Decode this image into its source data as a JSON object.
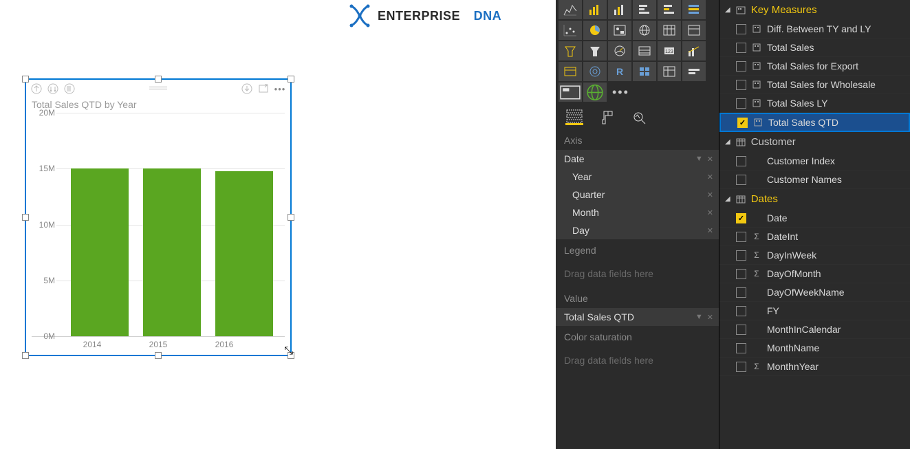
{
  "logo": {
    "ent": "ENTERPRISE",
    "dna": "DNA"
  },
  "chart_data": {
    "type": "bar",
    "title": "Total Sales QTD by Year",
    "categories": [
      "2014",
      "2015",
      "2016"
    ],
    "values": [
      15000000,
      15000000,
      14800000
    ],
    "ylabel": "",
    "y_ticks": [
      "0M",
      "5M",
      "10M",
      "15M",
      "20M"
    ],
    "ylim": [
      0,
      20000000
    ]
  },
  "viz_panel": {
    "tabs": [
      "fields",
      "format",
      "analytics"
    ],
    "wells": {
      "axis": {
        "title": "Axis",
        "field": "Date",
        "hierarchy": [
          "Year",
          "Quarter",
          "Month",
          "Day"
        ]
      },
      "legend": {
        "title": "Legend",
        "placeholder": "Drag data fields here"
      },
      "value": {
        "title": "Value",
        "field": "Total Sales QTD"
      },
      "color": {
        "title": "Color saturation",
        "placeholder": "Drag data fields here"
      }
    }
  },
  "fields_panel": {
    "tables": [
      {
        "name": "Key Measures",
        "gold": true,
        "icon": "calc",
        "fields": [
          {
            "name": "Diff. Between TY and LY",
            "checked": false,
            "type": "measure"
          },
          {
            "name": "Total Sales",
            "checked": false,
            "type": "measure"
          },
          {
            "name": "Total Sales for Export",
            "checked": false,
            "type": "measure"
          },
          {
            "name": "Total Sales for Wholesale",
            "checked": false,
            "type": "measure"
          },
          {
            "name": "Total Sales LY",
            "checked": false,
            "type": "measure"
          },
          {
            "name": "Total Sales QTD",
            "checked": true,
            "type": "measure",
            "highlight": true
          }
        ]
      },
      {
        "name": "Customer",
        "gold": false,
        "icon": "table",
        "fields": [
          {
            "name": "Customer Index",
            "checked": false,
            "type": "column"
          },
          {
            "name": "Customer Names",
            "checked": false,
            "type": "column"
          }
        ]
      },
      {
        "name": "Dates",
        "gold": true,
        "icon": "table",
        "fields": [
          {
            "name": "Date",
            "checked": true,
            "type": "column"
          },
          {
            "name": "DateInt",
            "checked": false,
            "type": "sigma"
          },
          {
            "name": "DayInWeek",
            "checked": false,
            "type": "sigma"
          },
          {
            "name": "DayOfMonth",
            "checked": false,
            "type": "sigma"
          },
          {
            "name": "DayOfWeekName",
            "checked": false,
            "type": "column"
          },
          {
            "name": "FY",
            "checked": false,
            "type": "column"
          },
          {
            "name": "MonthInCalendar",
            "checked": false,
            "type": "column"
          },
          {
            "name": "MonthName",
            "checked": false,
            "type": "column"
          },
          {
            "name": "MonthnYear",
            "checked": false,
            "type": "sigma"
          }
        ]
      }
    ]
  }
}
